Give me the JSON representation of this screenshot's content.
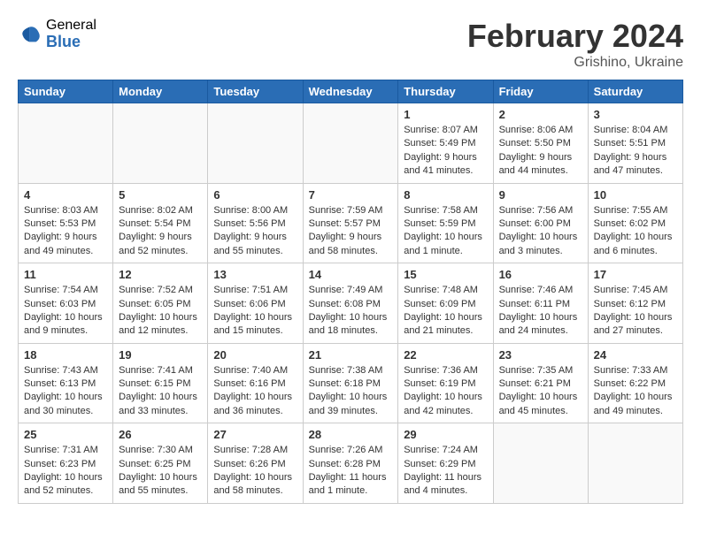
{
  "header": {
    "logo_general": "General",
    "logo_blue": "Blue",
    "month_title": "February 2024",
    "location": "Grishino, Ukraine"
  },
  "days_of_week": [
    "Sunday",
    "Monday",
    "Tuesday",
    "Wednesday",
    "Thursday",
    "Friday",
    "Saturday"
  ],
  "weeks": [
    [
      {
        "day": "",
        "info": ""
      },
      {
        "day": "",
        "info": ""
      },
      {
        "day": "",
        "info": ""
      },
      {
        "day": "",
        "info": ""
      },
      {
        "day": "1",
        "info": "Sunrise: 8:07 AM\nSunset: 5:49 PM\nDaylight: 9 hours and 41 minutes."
      },
      {
        "day": "2",
        "info": "Sunrise: 8:06 AM\nSunset: 5:50 PM\nDaylight: 9 hours and 44 minutes."
      },
      {
        "day": "3",
        "info": "Sunrise: 8:04 AM\nSunset: 5:51 PM\nDaylight: 9 hours and 47 minutes."
      }
    ],
    [
      {
        "day": "4",
        "info": "Sunrise: 8:03 AM\nSunset: 5:53 PM\nDaylight: 9 hours and 49 minutes."
      },
      {
        "day": "5",
        "info": "Sunrise: 8:02 AM\nSunset: 5:54 PM\nDaylight: 9 hours and 52 minutes."
      },
      {
        "day": "6",
        "info": "Sunrise: 8:00 AM\nSunset: 5:56 PM\nDaylight: 9 hours and 55 minutes."
      },
      {
        "day": "7",
        "info": "Sunrise: 7:59 AM\nSunset: 5:57 PM\nDaylight: 9 hours and 58 minutes."
      },
      {
        "day": "8",
        "info": "Sunrise: 7:58 AM\nSunset: 5:59 PM\nDaylight: 10 hours and 1 minute."
      },
      {
        "day": "9",
        "info": "Sunrise: 7:56 AM\nSunset: 6:00 PM\nDaylight: 10 hours and 3 minutes."
      },
      {
        "day": "10",
        "info": "Sunrise: 7:55 AM\nSunset: 6:02 PM\nDaylight: 10 hours and 6 minutes."
      }
    ],
    [
      {
        "day": "11",
        "info": "Sunrise: 7:54 AM\nSunset: 6:03 PM\nDaylight: 10 hours and 9 minutes."
      },
      {
        "day": "12",
        "info": "Sunrise: 7:52 AM\nSunset: 6:05 PM\nDaylight: 10 hours and 12 minutes."
      },
      {
        "day": "13",
        "info": "Sunrise: 7:51 AM\nSunset: 6:06 PM\nDaylight: 10 hours and 15 minutes."
      },
      {
        "day": "14",
        "info": "Sunrise: 7:49 AM\nSunset: 6:08 PM\nDaylight: 10 hours and 18 minutes."
      },
      {
        "day": "15",
        "info": "Sunrise: 7:48 AM\nSunset: 6:09 PM\nDaylight: 10 hours and 21 minutes."
      },
      {
        "day": "16",
        "info": "Sunrise: 7:46 AM\nSunset: 6:11 PM\nDaylight: 10 hours and 24 minutes."
      },
      {
        "day": "17",
        "info": "Sunrise: 7:45 AM\nSunset: 6:12 PM\nDaylight: 10 hours and 27 minutes."
      }
    ],
    [
      {
        "day": "18",
        "info": "Sunrise: 7:43 AM\nSunset: 6:13 PM\nDaylight: 10 hours and 30 minutes."
      },
      {
        "day": "19",
        "info": "Sunrise: 7:41 AM\nSunset: 6:15 PM\nDaylight: 10 hours and 33 minutes."
      },
      {
        "day": "20",
        "info": "Sunrise: 7:40 AM\nSunset: 6:16 PM\nDaylight: 10 hours and 36 minutes."
      },
      {
        "day": "21",
        "info": "Sunrise: 7:38 AM\nSunset: 6:18 PM\nDaylight: 10 hours and 39 minutes."
      },
      {
        "day": "22",
        "info": "Sunrise: 7:36 AM\nSunset: 6:19 PM\nDaylight: 10 hours and 42 minutes."
      },
      {
        "day": "23",
        "info": "Sunrise: 7:35 AM\nSunset: 6:21 PM\nDaylight: 10 hours and 45 minutes."
      },
      {
        "day": "24",
        "info": "Sunrise: 7:33 AM\nSunset: 6:22 PM\nDaylight: 10 hours and 49 minutes."
      }
    ],
    [
      {
        "day": "25",
        "info": "Sunrise: 7:31 AM\nSunset: 6:23 PM\nDaylight: 10 hours and 52 minutes."
      },
      {
        "day": "26",
        "info": "Sunrise: 7:30 AM\nSunset: 6:25 PM\nDaylight: 10 hours and 55 minutes."
      },
      {
        "day": "27",
        "info": "Sunrise: 7:28 AM\nSunset: 6:26 PM\nDaylight: 10 hours and 58 minutes."
      },
      {
        "day": "28",
        "info": "Sunrise: 7:26 AM\nSunset: 6:28 PM\nDaylight: 11 hours and 1 minute."
      },
      {
        "day": "29",
        "info": "Sunrise: 7:24 AM\nSunset: 6:29 PM\nDaylight: 11 hours and 4 minutes."
      },
      {
        "day": "",
        "info": ""
      },
      {
        "day": "",
        "info": ""
      }
    ]
  ]
}
